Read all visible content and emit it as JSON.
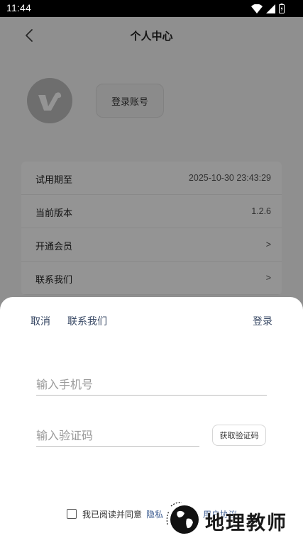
{
  "status_bar": {
    "time": "11:44",
    "icons": [
      "wifi-icon",
      "signal-icon",
      "battery-icon"
    ]
  },
  "background_page": {
    "title": "个人中心",
    "login_account_label": "登录账号",
    "rows": [
      {
        "label": "试用期至",
        "value": "2025-10-30 23:43:29"
      },
      {
        "label": "当前版本",
        "value": "1.2.6"
      },
      {
        "label": "开通会员",
        "value": ">"
      },
      {
        "label": "联系我们",
        "value": ">"
      }
    ]
  },
  "sheet": {
    "cancel_label": "取消",
    "contact_label": "联系我们",
    "login_label": "登录",
    "phone_placeholder": "输入手机号",
    "code_placeholder": "输入验证码",
    "get_code_label": "获取验证码",
    "agree_text": "我已阅读并同意",
    "privacy_link": "隐私",
    "link_separator": "",
    "terms_link": "用户协议"
  },
  "watermark": {
    "text": "地理教师"
  },
  "colors": {
    "scrim": "#000000",
    "link": "#3a5a8f",
    "sheet_action": "#3a4a66",
    "avatar": "#bdbdbd"
  }
}
